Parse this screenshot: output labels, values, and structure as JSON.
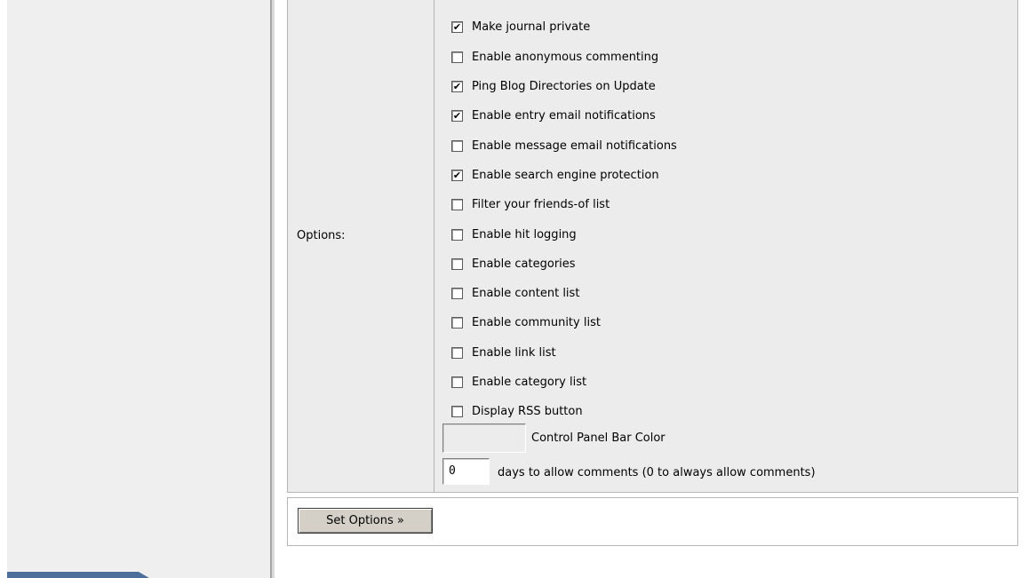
{
  "options": {
    "section_label": "Options:",
    "items": [
      {
        "label": "Make journal private",
        "checked": true
      },
      {
        "label": "Enable anonymous commenting",
        "checked": false
      },
      {
        "label": "Ping Blog Directories on Update",
        "checked": true
      },
      {
        "label": "Enable entry email notifications",
        "checked": true
      },
      {
        "label": "Enable message email notifications",
        "checked": false
      },
      {
        "label": "Enable search engine protection",
        "checked": true
      },
      {
        "label": "Filter your friends-of list",
        "checked": false
      },
      {
        "label": "Enable hit logging",
        "checked": false
      },
      {
        "label": "Enable categories",
        "checked": false
      },
      {
        "label": "Enable content list",
        "checked": false
      },
      {
        "label": "Enable community list",
        "checked": false
      },
      {
        "label": "Enable link list",
        "checked": false
      },
      {
        "label": "Enable category list",
        "checked": false
      },
      {
        "label": "Display RSS button",
        "checked": false
      }
    ],
    "color_field": {
      "value": "",
      "label": "Control Panel Bar Color"
    },
    "days_field": {
      "value": "0",
      "label": "days to allow comments (0 to always allow comments)"
    }
  },
  "actions": {
    "set_options_label": "Set Options »"
  },
  "colors": {
    "panel_background": "#ececec",
    "sidebar_background": "#efefef",
    "sidebar_tab": "#4d6f9b"
  }
}
